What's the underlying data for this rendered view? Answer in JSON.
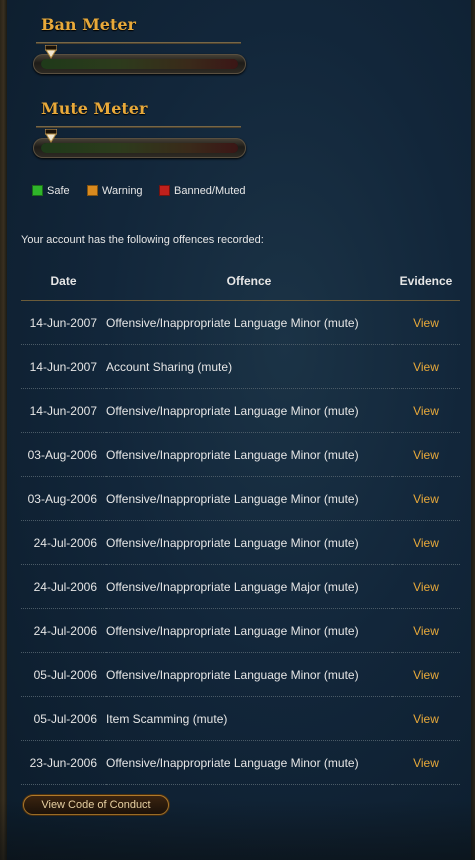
{
  "ban_meter": {
    "title": "Ban Meter",
    "level": 0.0
  },
  "mute_meter": {
    "title": "Mute Meter",
    "level": 0.0
  },
  "legend": [
    {
      "label": "Safe",
      "color": "#2fb52a"
    },
    {
      "label": "Warning",
      "color": "#d98a1e"
    },
    {
      "label": "Banned/Muted",
      "color": "#c0201c"
    }
  ],
  "intro_text": "Your account has the following offences recorded:",
  "table": {
    "headers": {
      "date": "Date",
      "offence": "Offence",
      "evidence": "Evidence"
    },
    "rows": [
      {
        "date": "14-Jun-2007",
        "offence": "Offensive/Inappropriate Language Minor (mute)",
        "evidence": "View"
      },
      {
        "date": "14-Jun-2007",
        "offence": "Account Sharing (mute)",
        "evidence": "View"
      },
      {
        "date": "14-Jun-2007",
        "offence": "Offensive/Inappropriate Language Minor (mute)",
        "evidence": "View"
      },
      {
        "date": "03-Aug-2006",
        "offence": "Offensive/Inappropriate Language Minor (mute)",
        "evidence": "View"
      },
      {
        "date": "03-Aug-2006",
        "offence": "Offensive/Inappropriate Language Minor (mute)",
        "evidence": "View"
      },
      {
        "date": "24-Jul-2006",
        "offence": "Offensive/Inappropriate Language Minor (mute)",
        "evidence": "View"
      },
      {
        "date": "24-Jul-2006",
        "offence": "Offensive/Inappropriate Language Major (mute)",
        "evidence": "View"
      },
      {
        "date": "24-Jul-2006",
        "offence": "Offensive/Inappropriate Language Minor (mute)",
        "evidence": "View"
      },
      {
        "date": "05-Jul-2006",
        "offence": "Offensive/Inappropriate Language Minor (mute)",
        "evidence": "View"
      },
      {
        "date": "05-Jul-2006",
        "offence": "Item Scamming (mute)",
        "evidence": "View"
      },
      {
        "date": "23-Jun-2006",
        "offence": "Offensive/Inappropriate Language Minor (mute)",
        "evidence": "View"
      }
    ]
  },
  "code_of_conduct_button": "View Code of Conduct",
  "colors": {
    "accent_gold": "#e8a93a",
    "background": "#12263a",
    "text": "#e6e6e6"
  }
}
